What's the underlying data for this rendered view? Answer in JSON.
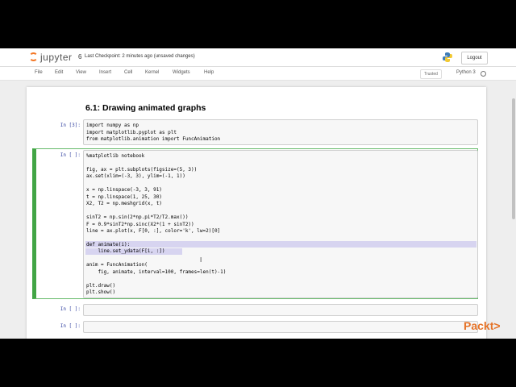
{
  "header": {
    "logo_text": "jupyter",
    "notebook_name": "6",
    "checkpoint": "Last Checkpoint: 2 minutes ago  (unsaved changes)",
    "logout_label": "Logout"
  },
  "menu": {
    "items": [
      "File",
      "Edit",
      "View",
      "Insert",
      "Cell",
      "Kernel",
      "Widgets",
      "Help"
    ],
    "trusted_label": "Trusted",
    "kernel_name": "Python 3"
  },
  "notebook": {
    "heading": "6.1: Drawing animated graphs",
    "cells": [
      {
        "prompt": "In [3]:",
        "lines": [
          "import numpy as np",
          "import matplotlib.pyplot as plt",
          "from matplotlib.animation import FuncAnimation"
        ]
      },
      {
        "prompt": "In [ ]:",
        "lines": [
          "%matplotlib notebook",
          "",
          "fig, ax = plt.subplots(figsize=(5, 3))",
          "ax.set(xlim=(-3, 3), ylim=(-1, 1))",
          "",
          "x = np.linspace(-3, 3, 91)",
          "t = np.linspace(1, 25, 30)",
          "X2, T2 = np.meshgrid(x, t)",
          "",
          "sinT2 = np.sin(2*np.pi*T2/T2.max())",
          "F = 0.9*sinT2*np.sinc(X2*(1 + sinT2))",
          "line = ax.plot(x, F[0, :], color='k', lw=2)[0]",
          "",
          "def animate(i):",
          "    line.set_ydata(F[i, :])",
          "",
          "anim = FuncAnimation(",
          "    fig, animate, interval=100, frames=len(t)-1)",
          "",
          "plt.draw()",
          "plt.show()"
        ]
      },
      {
        "prompt": "In [ ]:",
        "lines": []
      },
      {
        "prompt": "In [ ]:",
        "lines": []
      }
    ]
  },
  "watermark": "Packt>",
  "colors": {
    "accent": "#f37726",
    "prompt": "#303f9f",
    "active_border": "#42a545",
    "watermark": "#e57328"
  }
}
